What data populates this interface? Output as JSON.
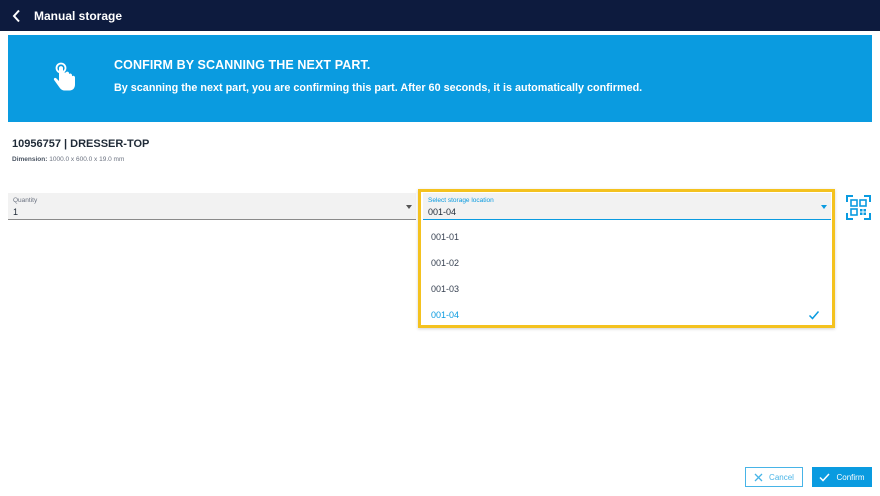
{
  "header": {
    "title": "Manual storage",
    "back_icon": "chevron-left-icon",
    "background_color": "#0d1b3e"
  },
  "banner": {
    "icon": "tap-hand-icon",
    "title": "CONFIRM BY SCANNING THE NEXT PART.",
    "text": "By scanning the next part, you are confirming this part. After 60 seconds, it is automatically confirmed.",
    "background_color": "#0a9be0"
  },
  "part": {
    "title": "10956757 | DRESSER-TOP",
    "dimension_label": "Dimension:",
    "dimension_value": "1000.0 x 600.0 x 19.0 mm"
  },
  "quantity": {
    "label": "Quantity",
    "value": "1"
  },
  "storage_location": {
    "label": "Select storage location",
    "value": "001-04",
    "options": [
      "001-01",
      "001-02",
      "001-03",
      "001-04"
    ],
    "selected_index": 3,
    "highlight_color": "#f4c21f"
  },
  "scan_button": {
    "icon": "qr-scan-icon"
  },
  "actions": {
    "cancel_label": "Cancel",
    "confirm_label": "Confirm",
    "accent_color": "#0a9be0"
  }
}
